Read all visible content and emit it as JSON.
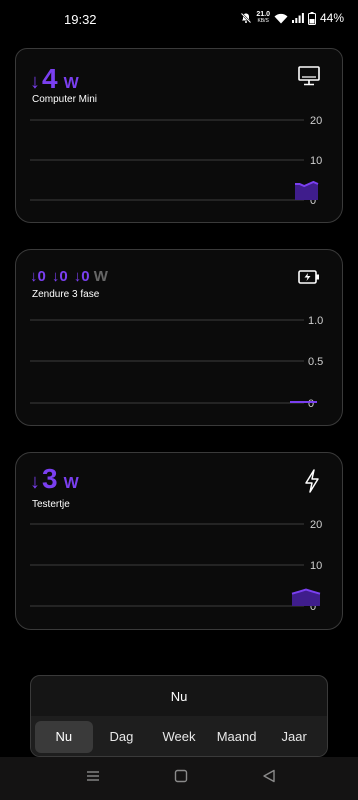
{
  "status_bar": {
    "time": "19:32",
    "net_speed_value": "21.0",
    "net_speed_unit": "KB/S",
    "battery": "44%",
    "icons": [
      "mute-icon",
      "wifi-icon",
      "signal-icon",
      "battery-icon"
    ]
  },
  "cards": [
    {
      "name": "Computer Mini",
      "arrow": "↓",
      "value": "4",
      "unit": "W",
      "icon": "monitor-icon",
      "chart": {
        "ticks": [
          "20",
          "10",
          "0"
        ]
      }
    },
    {
      "name": "Zendure 3 fase",
      "phases": [
        {
          "arrow": "↓",
          "value": "0"
        },
        {
          "arrow": "↓",
          "value": "0"
        },
        {
          "arrow": "↓",
          "value": "0"
        }
      ],
      "unit": "W",
      "icon": "battery-charging-icon",
      "chart": {
        "ticks": [
          "1.0",
          "0.5",
          "0"
        ]
      }
    },
    {
      "name": "Testertje",
      "arrow": "↓",
      "value": "3",
      "unit": "W",
      "icon": "lightning-icon",
      "chart": {
        "ticks": [
          "20",
          "10",
          "0"
        ]
      }
    }
  ],
  "chart_data": [
    {
      "type": "area",
      "title": "Computer Mini",
      "ylim": [
        0,
        20
      ],
      "values": [
        4,
        4,
        3.5,
        4,
        4.5,
        4
      ]
    },
    {
      "type": "line",
      "title": "Zendure 3 fase",
      "ylim": [
        0,
        1.0
      ],
      "values": [
        0,
        0,
        0
      ]
    },
    {
      "type": "area",
      "title": "Testertje",
      "ylim": [
        0,
        20
      ],
      "values": [
        3,
        3.5,
        4,
        3.5,
        3
      ]
    }
  ],
  "period": {
    "current": "Nu",
    "tabs": [
      "Nu",
      "Dag",
      "Week",
      "Maand",
      "Jaar"
    ],
    "active": "Nu"
  },
  "nav": {
    "icons": [
      "menu-icon",
      "home-icon",
      "back-icon"
    ]
  },
  "colors": {
    "accent": "#7a3ff0",
    "card_border": "#3a3a3a"
  }
}
